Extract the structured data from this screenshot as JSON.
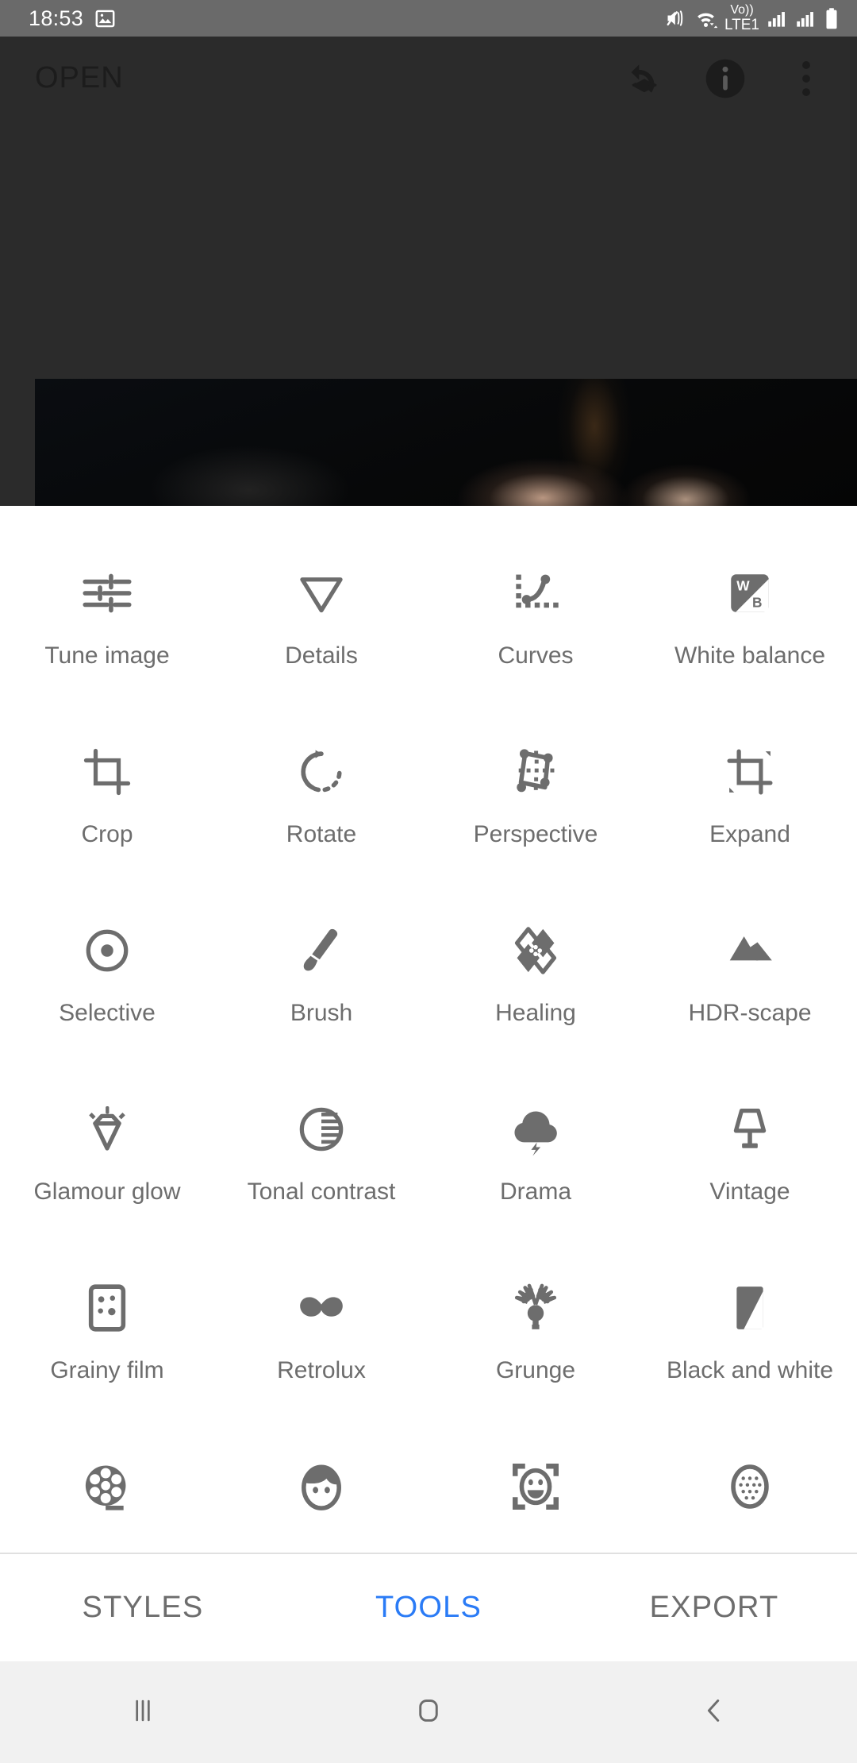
{
  "status_bar": {
    "time": "18:53",
    "left_icons": [
      "image-icon"
    ],
    "right_icons": [
      "mute-vibrate-icon",
      "wifi-icon",
      "volte-lte1-icon",
      "signal-bars-sim1-icon",
      "signal-bars-sim2-icon",
      "battery-icon"
    ],
    "volte_label": "Vo))",
    "network_label": "LTE1",
    "background": "#6a6a6a"
  },
  "app_bar": {
    "title": "OPEN",
    "actions": [
      {
        "name": "edit-stack-icon",
        "label": "Edit stack"
      },
      {
        "name": "info-icon",
        "label": "Info"
      },
      {
        "name": "overflow-menu-icon",
        "label": "More options"
      }
    ]
  },
  "editor": {
    "background": "#2b2b2b",
    "photo_name": "edited-photo-preview"
  },
  "tools": {
    "items": [
      {
        "label": "Tune image",
        "icon": "tune-sliders-icon"
      },
      {
        "label": "Details",
        "icon": "details-triangle-icon"
      },
      {
        "label": "Curves",
        "icon": "curves-icon"
      },
      {
        "label": "White balance",
        "icon": "white-balance-icon"
      },
      {
        "label": "Crop",
        "icon": "crop-icon"
      },
      {
        "label": "Rotate",
        "icon": "rotate-icon"
      },
      {
        "label": "Perspective",
        "icon": "perspective-icon"
      },
      {
        "label": "Expand",
        "icon": "expand-icon"
      },
      {
        "label": "Selective",
        "icon": "selective-icon"
      },
      {
        "label": "Brush",
        "icon": "brush-icon"
      },
      {
        "label": "Healing",
        "icon": "healing-icon"
      },
      {
        "label": "HDR-scape",
        "icon": "hdr-scape-icon"
      },
      {
        "label": "Glamour glow",
        "icon": "glamour-glow-icon"
      },
      {
        "label": "Tonal contrast",
        "icon": "tonal-contrast-icon"
      },
      {
        "label": "Drama",
        "icon": "drama-cloud-icon"
      },
      {
        "label": "Vintage",
        "icon": "vintage-lamp-icon"
      },
      {
        "label": "Grainy film",
        "icon": "grainy-film-icon"
      },
      {
        "label": "Retrolux",
        "icon": "retrolux-mustache-icon"
      },
      {
        "label": "Grunge",
        "icon": "grunge-spraycan-icon"
      },
      {
        "label": "Black and white",
        "icon": "black-and-white-icon"
      },
      {
        "label": "",
        "icon": "film-reel-icon"
      },
      {
        "label": "",
        "icon": "portrait-head-icon"
      },
      {
        "label": "",
        "icon": "head-pose-icon"
      },
      {
        "label": "",
        "icon": "lens-blur-icon"
      }
    ],
    "icon_color": "#6d6d6d",
    "label_color": "#6d6d6d"
  },
  "tab_bar": {
    "tabs": [
      {
        "label": "STYLES",
        "active": false
      },
      {
        "label": "TOOLS",
        "active": true
      },
      {
        "label": "EXPORT",
        "active": false
      }
    ],
    "active_color": "#2a7bf6",
    "inactive_color": "#6d6d6d"
  },
  "nav_bar": {
    "buttons": [
      {
        "name": "recents-button",
        "icon": "recents-icon"
      },
      {
        "name": "home-button",
        "icon": "home-icon"
      },
      {
        "name": "back-button",
        "icon": "back-chevron-icon"
      }
    ],
    "background": "#f1f1f1"
  }
}
